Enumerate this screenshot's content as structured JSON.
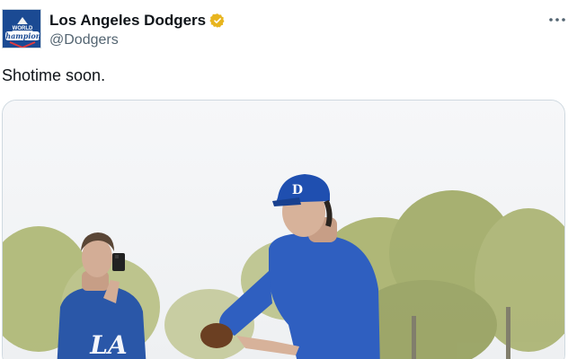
{
  "author": {
    "name": "Los Angeles Dodgers",
    "handle": "@Dodgers",
    "verified": true,
    "verified_color": "#e8b51f",
    "avatar": {
      "icon": "world-champions-logo",
      "text_top": "WORLD",
      "text_script": "Champions"
    }
  },
  "tweet": {
    "text": "Shotime soon.",
    "more_icon": "ellipsis-icon"
  },
  "media": {
    "type": "photo",
    "jersey_lettering": "LA",
    "cap_letter": "D"
  },
  "colors": {
    "dodger_blue": "#1f5fb8",
    "text_secondary": "#536471"
  }
}
